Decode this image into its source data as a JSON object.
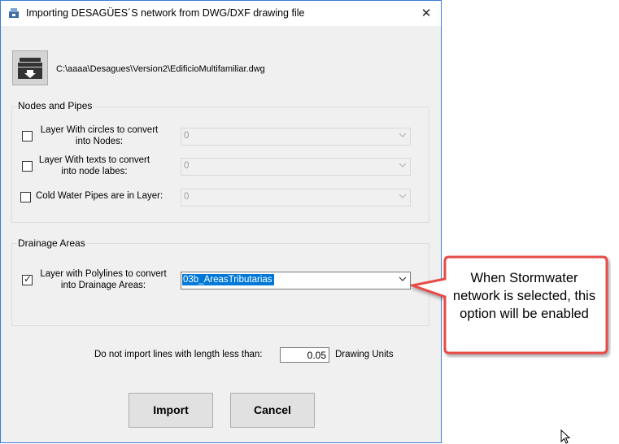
{
  "window": {
    "title": "Importing DESAGÜES´S network from DWG/DXF drawing file",
    "close_glyph": "✕",
    "accent_color": "#3c7bd6"
  },
  "file": {
    "path": "C:\\aaaa\\Desagues\\Version2\\EdificioMultifamiliar.dwg",
    "browse_icon": "database-download-icon"
  },
  "nodes_pipes": {
    "title": "Nodes and Pipes",
    "rows": [
      {
        "label_line1": "Layer With circles to convert",
        "label_line2": "into Nodes:",
        "checked": false,
        "value": "0"
      },
      {
        "label_line1": "Layer With texts to convert",
        "label_line2": "into node labes:",
        "checked": false,
        "value": "0"
      },
      {
        "label": "Cold Water Pipes are in Layer:",
        "checked": false,
        "value": "0"
      }
    ]
  },
  "drainage": {
    "title": "Drainage Areas",
    "row": {
      "label_line1": "Layer with Polylines to convert",
      "label_line2": "into Drainage Areas:",
      "checked": true,
      "value": "03b_AreasTributarias"
    }
  },
  "min_length": {
    "label": "Do not import lines with length less than:",
    "value": "0.05",
    "units": "Drawing Units"
  },
  "buttons": {
    "import": "Import",
    "cancel": "Cancel"
  },
  "callout": {
    "text": "When Stormwater network is selected, this option will be enabled",
    "border_color": "#e74c47"
  }
}
